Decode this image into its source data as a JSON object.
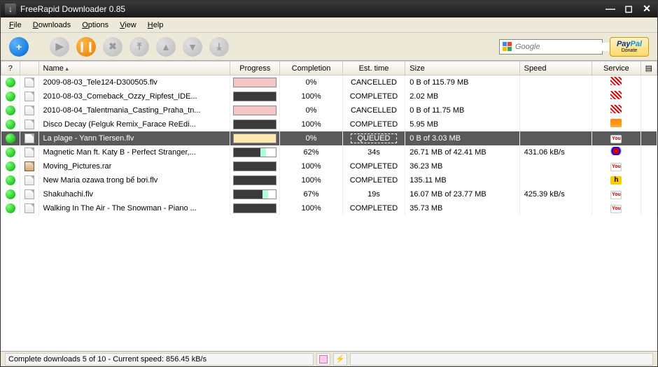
{
  "window": {
    "title": "FreeRapid Downloader 0.85"
  },
  "menu": {
    "file": "File",
    "downloads": "Downloads",
    "options": "Options",
    "view": "View",
    "help": "Help"
  },
  "search": {
    "placeholder": "Google"
  },
  "donate": {
    "brand1": "Pay",
    "brand2": "Pal",
    "label": "Donate"
  },
  "columns": {
    "q": "?",
    "name": "Name",
    "progress": "Progress",
    "completion": "Completion",
    "est": "Est. time",
    "size": "Size",
    "speed": "Speed",
    "service": "Service"
  },
  "rows": [
    {
      "status": "green",
      "icon": "file",
      "name": "2009-08-03_Tele124-D300505.flv",
      "progress": 0,
      "progress_style": "cancelled",
      "completion": "0%",
      "est": "CANCELLED",
      "size": "0 B of 115.79 MB",
      "speed": "",
      "service": "red",
      "selected": false
    },
    {
      "status": "green",
      "icon": "file",
      "name": "2010-08-03_Comeback_Ozzy_Ripfest_IDE...",
      "progress": 100,
      "progress_style": "done",
      "completion": "100%",
      "est": "COMPLETED",
      "size": "2.02 MB",
      "speed": "",
      "service": "red",
      "selected": false
    },
    {
      "status": "green",
      "icon": "file",
      "name": "2010-08-04_Talentmania_Casting_Praha_tn...",
      "progress": 0,
      "progress_style": "cancelled",
      "completion": "0%",
      "est": "CANCELLED",
      "size": "0 B of 11.75 MB",
      "speed": "",
      "service": "red",
      "selected": false
    },
    {
      "status": "green",
      "icon": "file",
      "name": "Disco Decay (Felguk Remix_Farace ReEdi...",
      "progress": 100,
      "progress_style": "done",
      "completion": "100%",
      "est": "COMPLETED",
      "size": "5.95 MB",
      "speed": "",
      "service": "orange",
      "selected": false
    },
    {
      "status": "green",
      "icon": "file",
      "name": "La plage - Yann Tiersen.flv",
      "progress": 0,
      "progress_style": "queued",
      "completion": "0%",
      "est": "QUEUED",
      "size": "0 B of 3.03 MB",
      "speed": "",
      "service": "youtube",
      "selected": true
    },
    {
      "status": "green",
      "icon": "file",
      "name": "Magnetic Man ft. Katy B - Perfect Stranger,...",
      "progress": 62,
      "progress_style": "partial",
      "completion": "62%",
      "est": "34s",
      "size": "26.71 MB of 42.41 MB",
      "speed": "431.06 kB/s",
      "service": "wave",
      "selected": false
    },
    {
      "status": "green",
      "icon": "rar",
      "name": "Moving_Pictures.rar",
      "progress": 100,
      "progress_style": "done",
      "completion": "100%",
      "est": "COMPLETED",
      "size": "36.23 MB",
      "speed": "",
      "service": "youtube",
      "selected": false
    },
    {
      "status": "green",
      "icon": "file",
      "name": "New Maria ozawa trong bể bơi.flv",
      "progress": 100,
      "progress_style": "done",
      "completion": "100%",
      "est": "COMPLETED",
      "size": "135.11 MB",
      "speed": "",
      "service": "h",
      "selected": false
    },
    {
      "status": "green",
      "icon": "file",
      "name": "Shakuhachi.flv",
      "progress": 67,
      "progress_style": "partial",
      "completion": "67%",
      "est": "19s",
      "size": "16.07 MB of 23.77 MB",
      "speed": "425.39 kB/s",
      "service": "youtube",
      "selected": false
    },
    {
      "status": "green",
      "icon": "file",
      "name": "Walking In The Air - The Snowman - Piano ...",
      "progress": 100,
      "progress_style": "done",
      "completion": "100%",
      "est": "COMPLETED",
      "size": "35.73 MB",
      "speed": "",
      "service": "youtube",
      "selected": false
    }
  ],
  "statusbar": {
    "text": "Complete downloads 5 of 10 - Current speed: 856.45 kB/s"
  }
}
